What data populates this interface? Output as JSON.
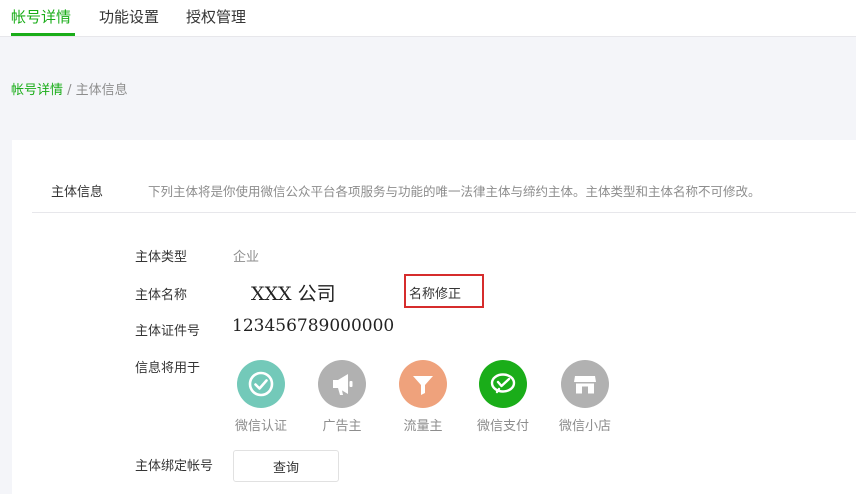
{
  "tabs": [
    {
      "label": "帐号详情",
      "active": true
    },
    {
      "label": "功能设置",
      "active": false
    },
    {
      "label": "授权管理",
      "active": false
    }
  ],
  "breadcrumb": {
    "root": "帐号详情",
    "separator": " / ",
    "current": "主体信息"
  },
  "section": {
    "title": "主体信息",
    "description": "下列主体将是你使用微信公众平台各项服务与功能的唯一法律主体与缔约主体。主体类型和主体名称不可修改。"
  },
  "fields": {
    "type_label": "主体类型",
    "type_value": "企业",
    "name_label": "主体名称",
    "name_value": "XXX 公司",
    "name_fix_link": "名称修正",
    "cert_label": "主体证件号",
    "cert_value": "123456789000000",
    "usage_label": "信息将用于",
    "bound_label": "主体绑定帐号",
    "query_button": "查询"
  },
  "usages": [
    {
      "label": "微信认证",
      "icon": "check-icon",
      "color": "#73c9b9"
    },
    {
      "label": "广告主",
      "icon": "megaphone-icon",
      "color": "#b1b1b1"
    },
    {
      "label": "流量主",
      "icon": "funnel-icon",
      "color": "#efa27c"
    },
    {
      "label": "微信支付",
      "icon": "wechat-pay-icon",
      "color": "#1aad19"
    },
    {
      "label": "微信小店",
      "icon": "store-icon",
      "color": "#b1b1b1"
    }
  ],
  "colors": {
    "accent": "#1aad19",
    "highlight_border": "#d62c2c"
  }
}
